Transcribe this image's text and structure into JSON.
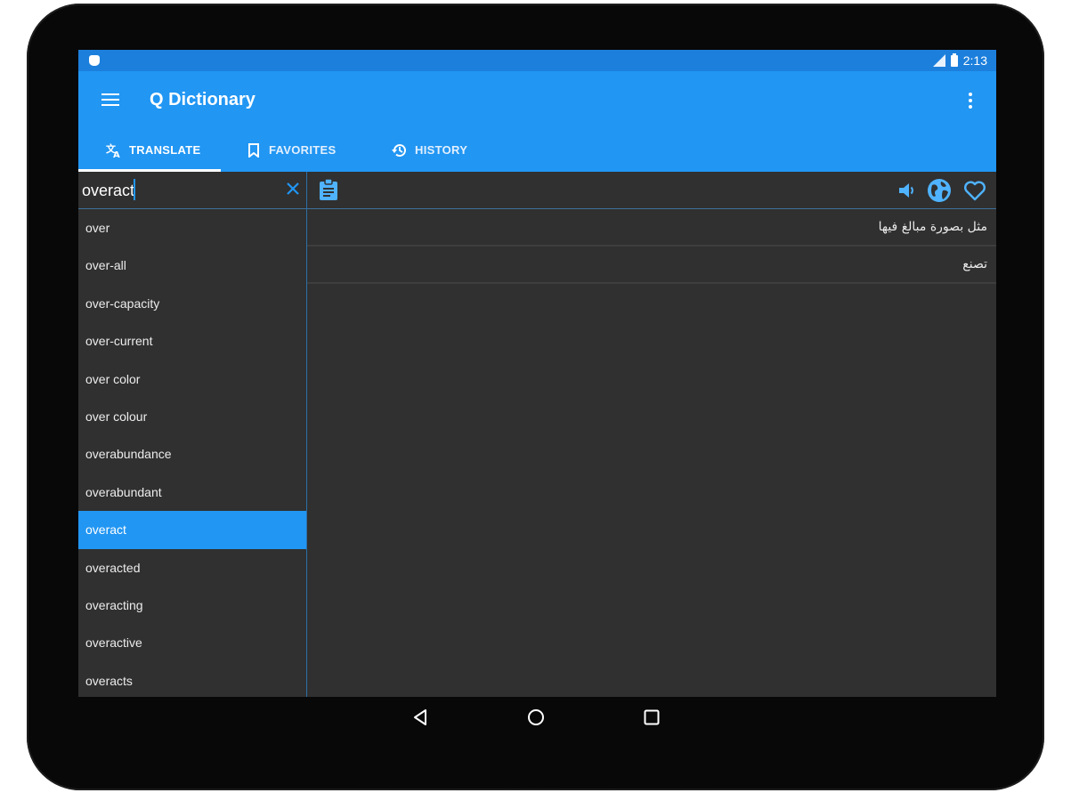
{
  "status_bar": {
    "time": "2:13"
  },
  "app_bar": {
    "title": "Q Dictionary",
    "menu_icon": "hamburger-menu-icon",
    "overflow_icon": "more-vert-icon"
  },
  "tabs": [
    {
      "label": "TRANSLATE",
      "icon": "translate-icon",
      "active": true
    },
    {
      "label": "FAVORITES",
      "icon": "bookmark-icon",
      "active": false
    },
    {
      "label": "HISTORY",
      "icon": "history-icon",
      "active": false
    }
  ],
  "search": {
    "value": "overact",
    "clear_icon": "close-icon"
  },
  "word_list": [
    "over",
    "over-all",
    "over-capacity",
    "over-current",
    "over color",
    "over colour",
    "overabundance",
    "overabundant",
    "overact",
    "overacted",
    "overacting",
    "overactive",
    "overacts"
  ],
  "selected_word": "overact",
  "detail_toolbar": {
    "left_icon": "clipboard-icon",
    "right_icons": [
      "speaker-icon",
      "globe-icon",
      "heart-icon"
    ]
  },
  "translations": [
    "مثل بصورة مبالغ فيها",
    "تصنع"
  ],
  "nav_bar": [
    "back-icon",
    "home-icon",
    "recents-icon"
  ],
  "colors": {
    "primary": "#2196f3",
    "status_bar": "#1c7fdc",
    "background": "#303030",
    "accent_icon": "#4fb3ff"
  }
}
